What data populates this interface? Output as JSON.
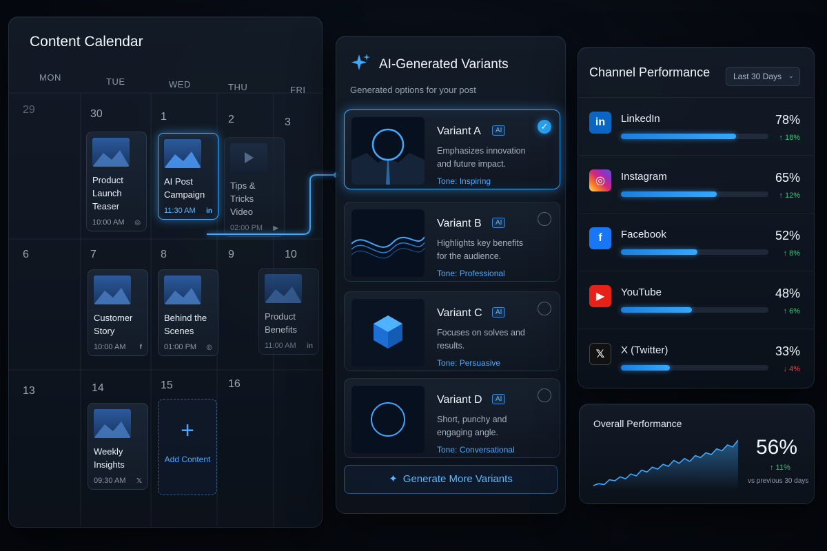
{
  "calendar": {
    "title": "Content Calendar",
    "days_of_week": [
      "MON",
      "TUE",
      "WED",
      "THU",
      "FRI"
    ],
    "weeks": [
      [
        "29",
        "30",
        "1",
        "2",
        "3"
      ],
      [
        "6",
        "7",
        "8",
        "9",
        "10"
      ],
      [
        "13",
        "14",
        "15",
        "16",
        ""
      ]
    ],
    "events": [
      {
        "title": "Product Launch Teaser",
        "time": "10:00 AM",
        "channel_icon": "instagram-icon",
        "icon_glyph": "◎"
      },
      {
        "title": "AI Post Campaign",
        "time": "11:30 AM",
        "channel_icon": "linkedin-icon",
        "icon_glyph": "in"
      },
      {
        "title": "Tips & Tricks Video",
        "time": "02:00 PM",
        "channel_icon": "youtube-icon",
        "icon_glyph": "▶"
      },
      {
        "title": "Customer Story",
        "time": "10:00 AM",
        "channel_icon": "facebook-icon",
        "icon_glyph": "f"
      },
      {
        "title": "Behind the Scenes",
        "time": "01:00 PM",
        "channel_icon": "instagram-icon",
        "icon_glyph": "◎"
      },
      {
        "title": "Product Benefits",
        "time": "11:00 AM",
        "channel_icon": "linkedin-icon",
        "icon_glyph": "in"
      },
      {
        "title": "Weekly Insights",
        "time": "09:30 AM",
        "channel_icon": "x-icon",
        "icon_glyph": "𝕏"
      }
    ],
    "add_content_label": "Add Content"
  },
  "variants": {
    "title": "AI-Generated Variants",
    "subtitle": "Generated options for your post",
    "badge": "AI",
    "items": [
      {
        "name": "Variant A",
        "description": "Emphasizes innovation and future impact.",
        "tone": "Tone: Inspiring",
        "selected": true
      },
      {
        "name": "Variant B",
        "description": "Highlights key benefits for the audience.",
        "tone": "Tone: Professional",
        "selected": false
      },
      {
        "name": "Variant C",
        "description": "Focuses on solves and results.",
        "tone": "Tone: Persuasive",
        "selected": false
      },
      {
        "name": "Variant D",
        "description": "Short, punchy and engaging angle.",
        "tone": "Tone: Conversational",
        "selected": false
      }
    ],
    "generate_button": "Generate More Variants"
  },
  "channels": {
    "title": "Channel Performance",
    "range": "Last 30 Days",
    "items": [
      {
        "name": "LinkedIn",
        "percent": "78%",
        "value": 0.78,
        "delta": "↑ 18%",
        "trend": "up",
        "icon": "linkedin-icon",
        "glyph": "in",
        "color": "#0a66c2"
      },
      {
        "name": "Instagram",
        "percent": "65%",
        "value": 0.65,
        "delta": "↑ 12%",
        "trend": "up",
        "icon": "instagram-icon",
        "glyph": "◎",
        "color": "#d62976"
      },
      {
        "name": "Facebook",
        "percent": "52%",
        "value": 0.52,
        "delta": "↑ 8%",
        "trend": "up",
        "icon": "facebook-icon",
        "glyph": "f",
        "color": "#1877f2"
      },
      {
        "name": "YouTube",
        "percent": "48%",
        "value": 0.48,
        "delta": "↑ 6%",
        "trend": "up",
        "icon": "youtube-icon",
        "glyph": "▶",
        "color": "#e62117"
      },
      {
        "name": "X (Twitter)",
        "percent": "33%",
        "value": 0.33,
        "delta": "↓ 4%",
        "trend": "down",
        "icon": "x-icon",
        "glyph": "𝕏",
        "color": "#111111"
      }
    ]
  },
  "overall": {
    "title": "Overall Performance",
    "percent": "56%",
    "delta": "↑ 11%",
    "note": "vs previous 30 days",
    "trend_values": [
      8,
      10,
      9,
      14,
      13,
      17,
      15,
      20,
      18,
      24,
      22,
      27,
      25,
      30,
      28,
      34,
      31,
      36,
      33,
      39,
      37,
      42,
      40,
      46,
      44,
      50,
      48,
      55
    ]
  },
  "colors": {
    "accent": "#3fa9ff",
    "positive": "#39c27a",
    "negative": "#e0464a"
  }
}
